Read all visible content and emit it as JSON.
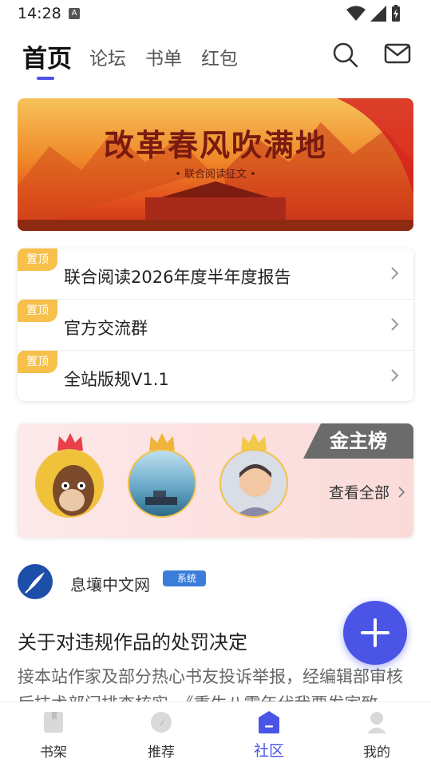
{
  "status_bar": {
    "time": "14:28",
    "indicator": "A"
  },
  "header": {
    "tabs": [
      {
        "label": "首页",
        "active": true
      },
      {
        "label": "论坛",
        "active": false
      },
      {
        "label": "书单",
        "active": false
      },
      {
        "label": "红包",
        "active": false
      }
    ],
    "icons": [
      "search-icon",
      "mail-icon"
    ]
  },
  "banner": {
    "title": "改革春风吹满地",
    "subtitle": "• 联合阅读征文 •"
  },
  "pinned": {
    "badge": "置顶",
    "items": [
      {
        "badge": "置顶",
        "title": "联合阅读2026年度半年度报告"
      },
      {
        "badge": "置顶",
        "title": "官方交流群"
      },
      {
        "badge": "置顶",
        "title": "全站版规V1.1"
      }
    ]
  },
  "gold_board": {
    "tag": "金主榜",
    "view_all": "查看全部"
  },
  "post": {
    "source": "息壤中文网",
    "tag": "系统",
    "title": "关于对违规作品的处罚决定",
    "body": "接本站作家及部分热心书友投诉举报，经编辑部审核后技术部门排查核实，《重生八零年代我要发家致"
  },
  "bottom_nav": [
    {
      "label": "书架",
      "active": false
    },
    {
      "label": "推荐",
      "active": false
    },
    {
      "label": "社区",
      "active": true
    },
    {
      "label": "我的",
      "active": false
    }
  ],
  "colors": {
    "accent": "#4a55e6",
    "pin_badge": "#f6c04a",
    "gold_tag": "#6b6b6b"
  }
}
